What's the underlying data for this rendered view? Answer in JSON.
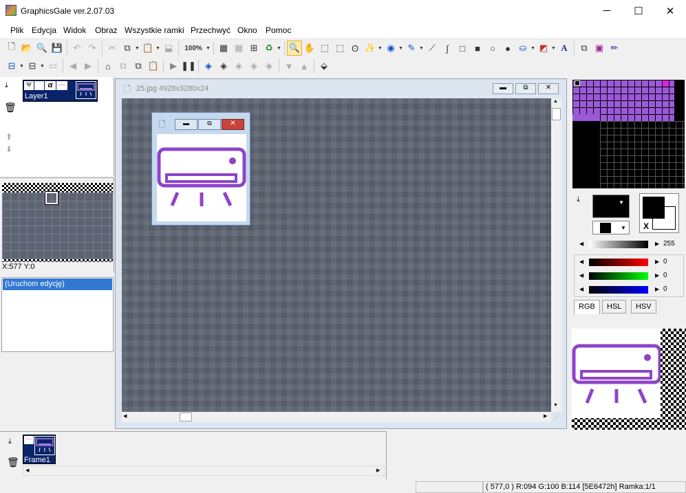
{
  "window": {
    "title": "GraphicsGale ver.2.07.03",
    "minimize": "─",
    "maximize": "☐",
    "close": "✕"
  },
  "menu": [
    "Plik",
    "Edycja",
    "Widok",
    "Obraz",
    "Wszystkie ramki",
    "Przechwyć",
    "Okno",
    "Pomoc"
  ],
  "toolbar": {
    "zoom": "100%",
    "text_tool": "A"
  },
  "layers": {
    "layer_name": "Layer1",
    "alpha": "α",
    "more": "···"
  },
  "navigator": {
    "coords": "X:577 Y:0"
  },
  "history": {
    "item": "(Uruchom edycję)"
  },
  "document": {
    "title": "25.jpg 4928x3280x24"
  },
  "palette": {
    "brightness": "255",
    "r": "0",
    "g": "0",
    "b": "0",
    "tabs": [
      "RGB",
      "HSL",
      "HSV"
    ],
    "x_label": "X"
  },
  "frames": {
    "frame_name": "Frame1",
    "more": "···"
  },
  "status": {
    "pixel_info": "( 577,0 ) R:094 G:100 B:114  [5E6472h]  Ramka:1/1"
  },
  "colors": {
    "accent": "#8e44c8",
    "canvas": "#5e6472",
    "selection": "#0a246a"
  }
}
